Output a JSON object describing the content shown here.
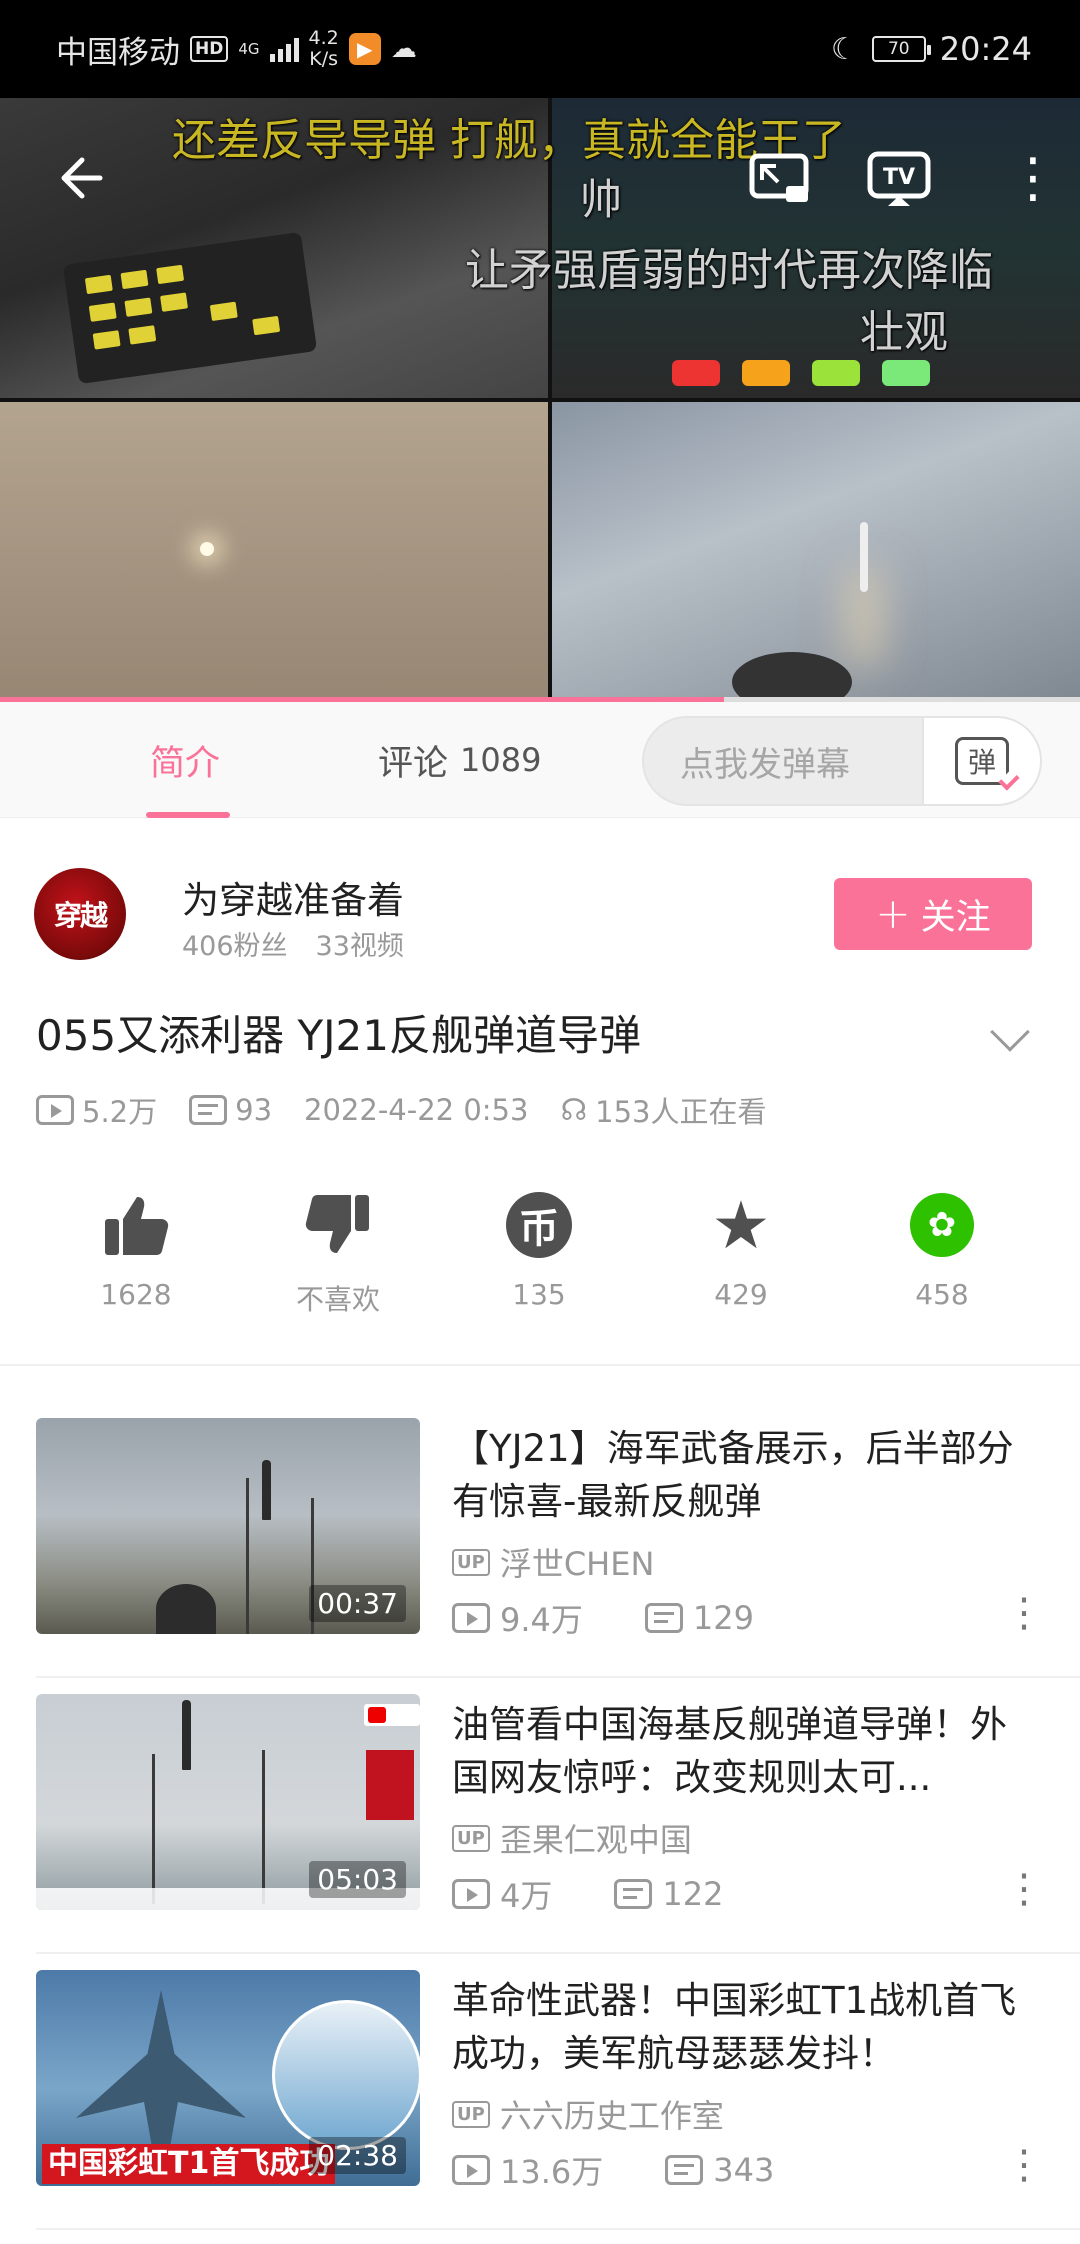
{
  "status_bar": {
    "carrier": "中国移动",
    "hd": "HD",
    "network": "4G",
    "speed_value": "4.2",
    "speed_unit": "K/s",
    "battery": "70",
    "time": "20:24"
  },
  "video": {
    "danmaku": [
      "还差反导导弹 打舰，真就全能王了",
      "帅",
      "让矛强盾弱的时代再次降临",
      "壮观"
    ],
    "progress": 0.67
  },
  "tabs": {
    "intro": "简介",
    "comments": "评论",
    "comments_count": "1089",
    "danmu_placeholder": "点我发弹幕",
    "danmu_button": "弹"
  },
  "uploader": {
    "avatar_text": "穿越",
    "name": "为穿越准备着",
    "fans": "406粉丝",
    "videos": "33视频",
    "follow_label": "关注"
  },
  "video_info": {
    "title": "055又添利器 YJ21反舰弹道导弹",
    "plays": "5.2万",
    "danmaku_count": "93",
    "date": "2022-4-22 0:53",
    "watching": "153人正在看"
  },
  "actions": {
    "like": "1628",
    "dislike": "不喜欢",
    "coin": "135",
    "favorite": "429",
    "share": "458"
  },
  "related": [
    {
      "title": "【YJ21】海军武备展示，后半部分有惊喜-最新反舰弹",
      "up_badge": "UP",
      "uploader": "浮世CHEN",
      "plays": "9.4万",
      "danmaku": "129",
      "duration": "00:37"
    },
    {
      "title": "油管看中国海基反舰弹道导弹！外国网友惊呼：改变规则太可...",
      "up_badge": "UP",
      "uploader": "歪果仁观中国",
      "plays": "4万",
      "danmaku": "122",
      "duration": "05:03"
    },
    {
      "title": "革命性武器！中国彩虹T1战机首飞成功，美军航母瑟瑟发抖！",
      "up_badge": "UP",
      "uploader": "六六历史工作室",
      "plays": "13.6万",
      "danmaku": "343",
      "duration": "02:38",
      "thumb_text": "中国彩虹T1首飞成功"
    }
  ],
  "colors": {
    "accent": "#fb7299",
    "wechat": "#2dc100"
  },
  "icons": [
    "back-arrow-icon",
    "cast-icon",
    "tv-icon",
    "more-vertical-icon",
    "thumbs-up-icon",
    "thumbs-down-icon",
    "coin-icon",
    "star-icon",
    "wechat-icon",
    "play-count-icon",
    "danmaku-count-icon",
    "watching-people-icon",
    "chevron-down-icon"
  ]
}
